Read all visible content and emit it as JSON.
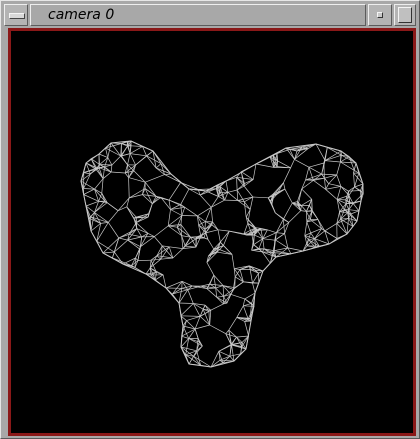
{
  "window": {
    "title": "camera 0"
  },
  "icons": {
    "window_menu": "window-menu-icon",
    "minimize": "minimize-icon",
    "maximize": "maximize-icon"
  },
  "colors": {
    "frame_border": "#8a1818",
    "viewport_background": "#000000",
    "wireframe": "#c8c8c8",
    "titlebar": "#a8a8a8"
  }
}
